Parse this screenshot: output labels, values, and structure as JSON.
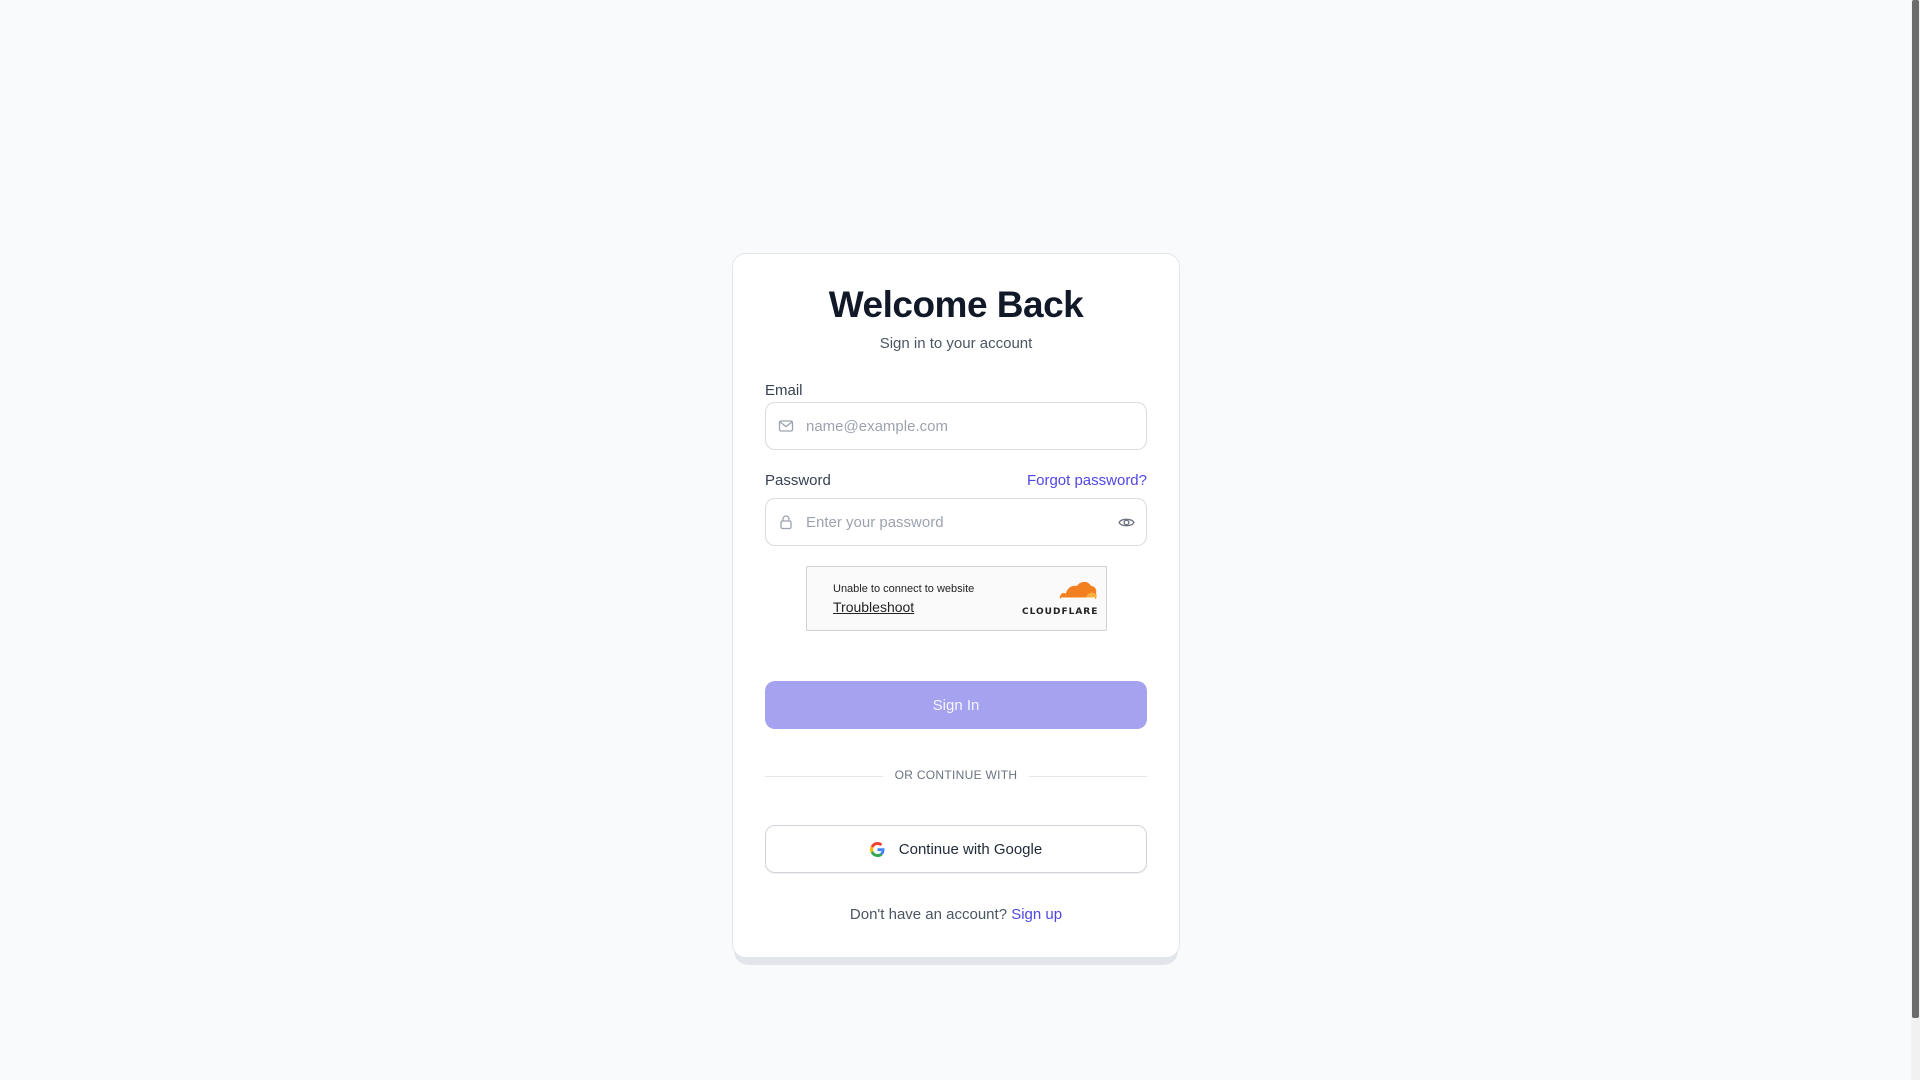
{
  "header": {
    "title": "Welcome Back",
    "subtitle": "Sign in to your account"
  },
  "email": {
    "label": "Email",
    "placeholder": "name@example.com",
    "icon": "mail-icon"
  },
  "password": {
    "label": "Password",
    "placeholder": "Enter your password",
    "forgot_label": "Forgot password?",
    "icon": "lock-icon",
    "toggle_icon": "eye-icon"
  },
  "turnstile": {
    "message": "Unable to connect to website",
    "link": "Troubleshoot",
    "logo_text": "CLOUDFLARE"
  },
  "actions": {
    "signin_label": "Sign In",
    "divider_label": "OR CONTINUE WITH",
    "google_label": "Continue with Google"
  },
  "footer": {
    "prompt": "Don't have an account?",
    "signup_label": "Sign up"
  },
  "colors": {
    "accent": "#4f46e5",
    "button_disabled": "#a5a3ef",
    "background": "#f8fafc"
  }
}
